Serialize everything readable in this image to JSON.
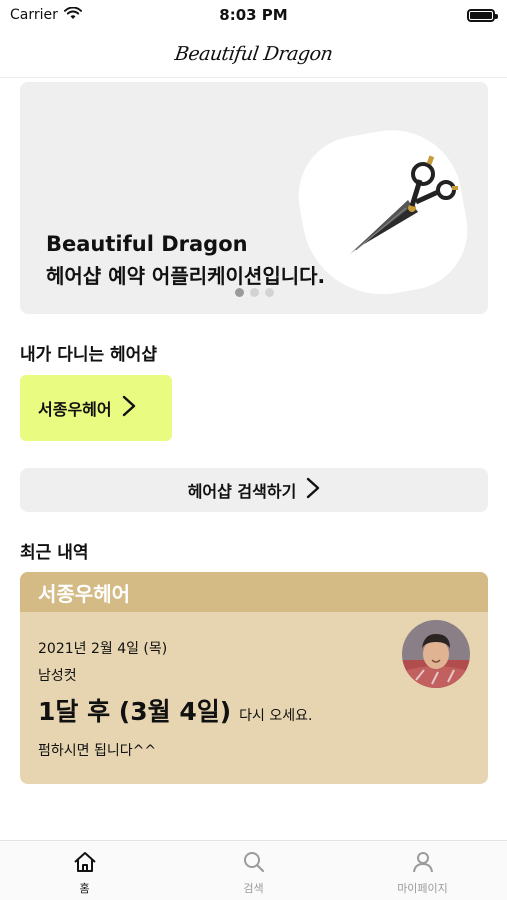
{
  "status_bar": {
    "carrier": "Carrier",
    "time": "8:03 PM"
  },
  "header": {
    "title": "Beautiful Dragon"
  },
  "banner": {
    "line1": "Beautiful Dragon",
    "line2": "헤어샵 예약 어플리케이션입니다.",
    "page_count": 3,
    "active_page": 1,
    "image_icon": "scissors-icon"
  },
  "my_shop": {
    "section_title": "내가 다니는 헤어샵",
    "shop_name": "서종우헤어",
    "card_color": "#eafb82"
  },
  "search": {
    "label": "헤어샵 검색하기"
  },
  "recent": {
    "section_title": "최근 내역",
    "shop_name": "서종우헤어",
    "date": "2021년 2월 4일 (목)",
    "service": "남성컷",
    "return_period": "1달 후 (3월 4일)",
    "return_suffix": "다시 오세요.",
    "note": "펌하시면 됩니다^^",
    "header_color": "#d4bb86",
    "body_color": "#e6d5b0"
  },
  "tabs": [
    {
      "label": "홈",
      "icon": "home-icon",
      "active": true
    },
    {
      "label": "검색",
      "icon": "search-icon",
      "active": false
    },
    {
      "label": "마이페이지",
      "icon": "person-icon",
      "active": false
    }
  ]
}
